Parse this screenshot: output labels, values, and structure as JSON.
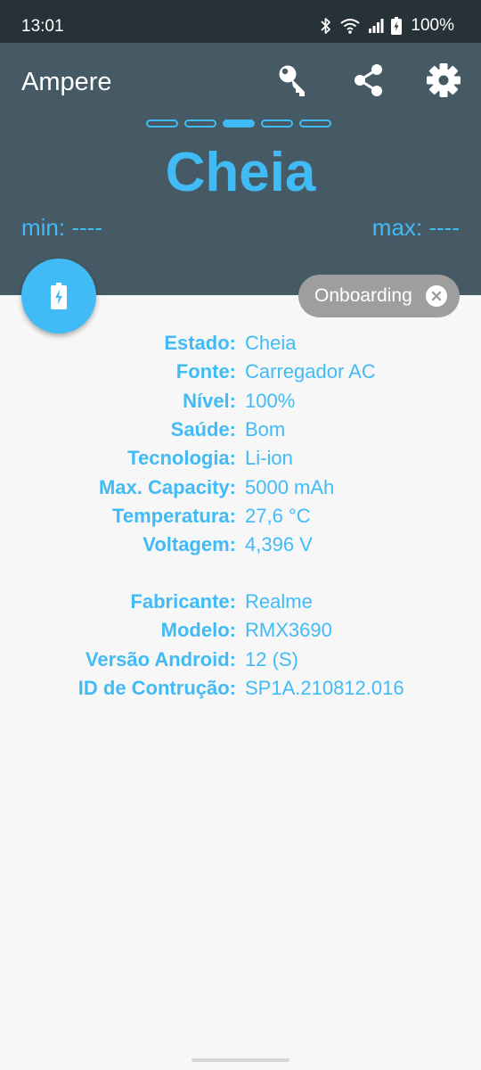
{
  "status_bar": {
    "time": "13:01",
    "battery": "100%"
  },
  "app": {
    "title": "Ampere"
  },
  "toolbar": {
    "icons": [
      "key-icon",
      "share-icon",
      "settings-icon"
    ]
  },
  "pager": {
    "count": 5,
    "active_index": 2
  },
  "charge_state": {
    "title": "Cheia",
    "min": "min: ----",
    "max": "max: ----"
  },
  "chip": {
    "label": "Onboarding"
  },
  "battery_info": [
    {
      "label": "Estado:",
      "value": "Cheia"
    },
    {
      "label": "Fonte:",
      "value": "Carregador AC"
    },
    {
      "label": "Nível:",
      "value": "100%"
    },
    {
      "label": "Saúde:",
      "value": "Bom"
    },
    {
      "label": "Tecnologia:",
      "value": "Li-ion"
    },
    {
      "label": "Max. Capacity:",
      "value": "5000 mAh"
    },
    {
      "label": "Temperatura:",
      "value": "27,6 °C"
    },
    {
      "label": "Voltagem:",
      "value": "4,396 V"
    }
  ],
  "device_info": [
    {
      "label": "Fabricante:",
      "value": "Realme"
    },
    {
      "label": "Modelo:",
      "value": "RMX3690"
    },
    {
      "label": "Versão Android:",
      "value": "12 (S)"
    },
    {
      "label": "ID de Contrução:",
      "value": "SP1A.210812.016"
    }
  ],
  "colors": {
    "accent": "#41bbf5",
    "header": "#455a64",
    "status_bar": "#263238",
    "background": "#f7f7f7",
    "chip": "#9e9e9e"
  }
}
